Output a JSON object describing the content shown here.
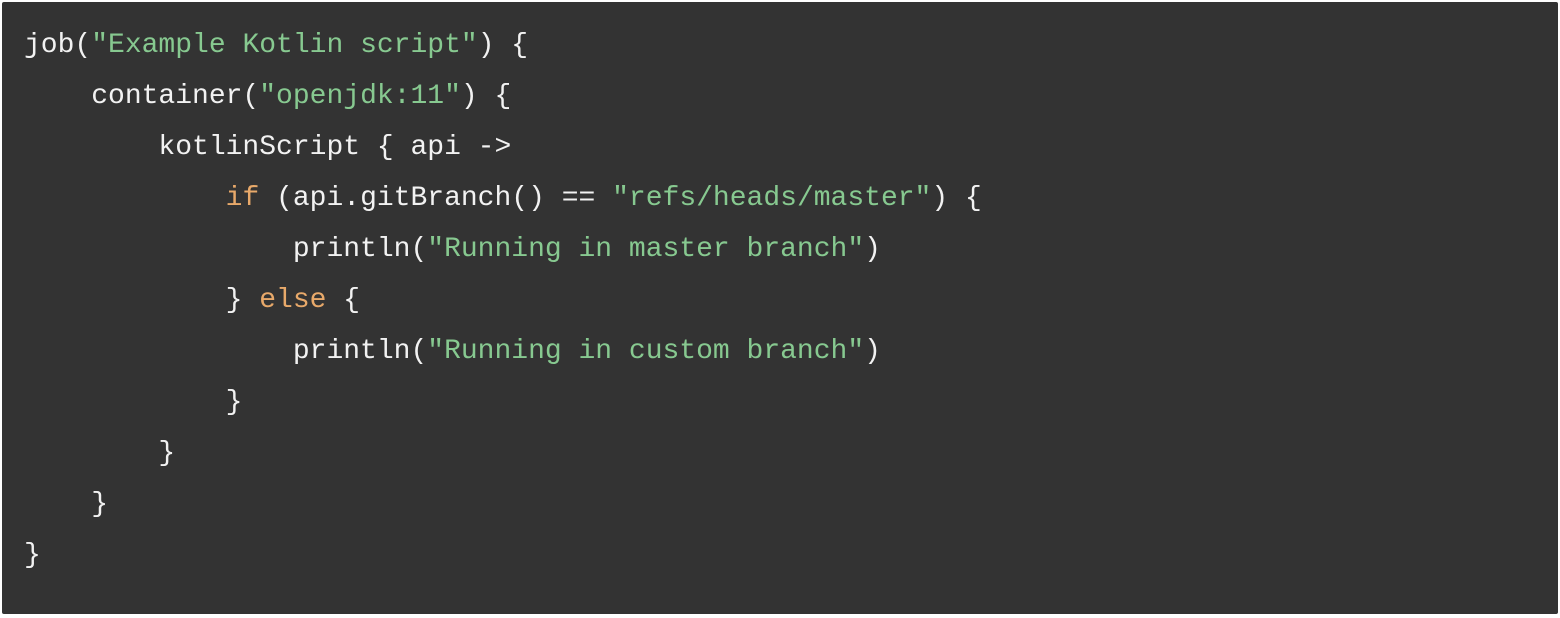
{
  "code": {
    "l1_fn": "job(",
    "l1_str": "\"Example Kotlin script\"",
    "l1_rest": ") {",
    "l2_pre": "    container(",
    "l2_str": "\"openjdk:11\"",
    "l2_rest": ") {",
    "l3": "        kotlinScript { api ->",
    "l4_pre": "            ",
    "l4_kw": "if",
    "l4_mid": " (api.gitBranch() == ",
    "l4_str": "\"refs/heads/master\"",
    "l4_rest": ") {",
    "l5_pre": "                println(",
    "l5_str": "\"Running in master branch\"",
    "l5_rest": ")",
    "l6_pre": "            } ",
    "l6_kw": "else",
    "l6_rest": " {",
    "l7_pre": "                println(",
    "l7_str": "\"Running in custom branch\"",
    "l7_rest": ")",
    "l8": "            }",
    "l9": "        }",
    "l10": "    }",
    "l11": "}"
  }
}
